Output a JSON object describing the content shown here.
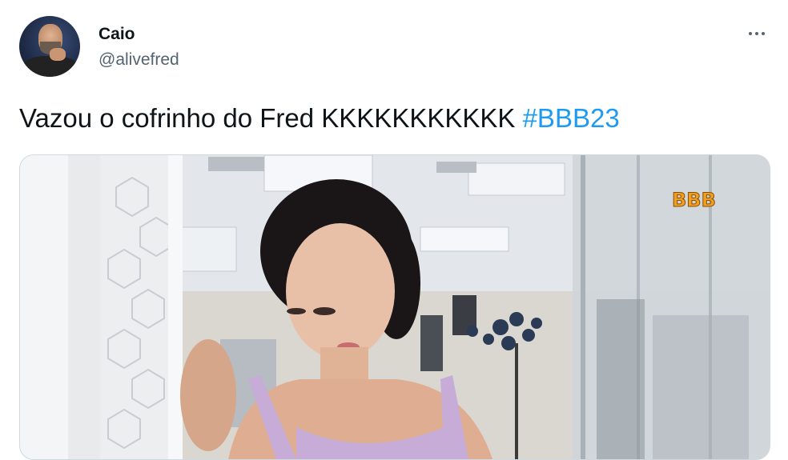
{
  "author": {
    "name": "Caio",
    "handle": "@alivefred"
  },
  "tweet": {
    "text": "Vazou o cofrinho do Fred KKKKKKKKKKK",
    "hashtag": "#BBB23"
  },
  "media": {
    "watermark": "BBB"
  },
  "colors": {
    "hashtag": "#1d9bf0",
    "muted": "#536471"
  },
  "icons": {
    "more": "more-horizontal-icon"
  }
}
